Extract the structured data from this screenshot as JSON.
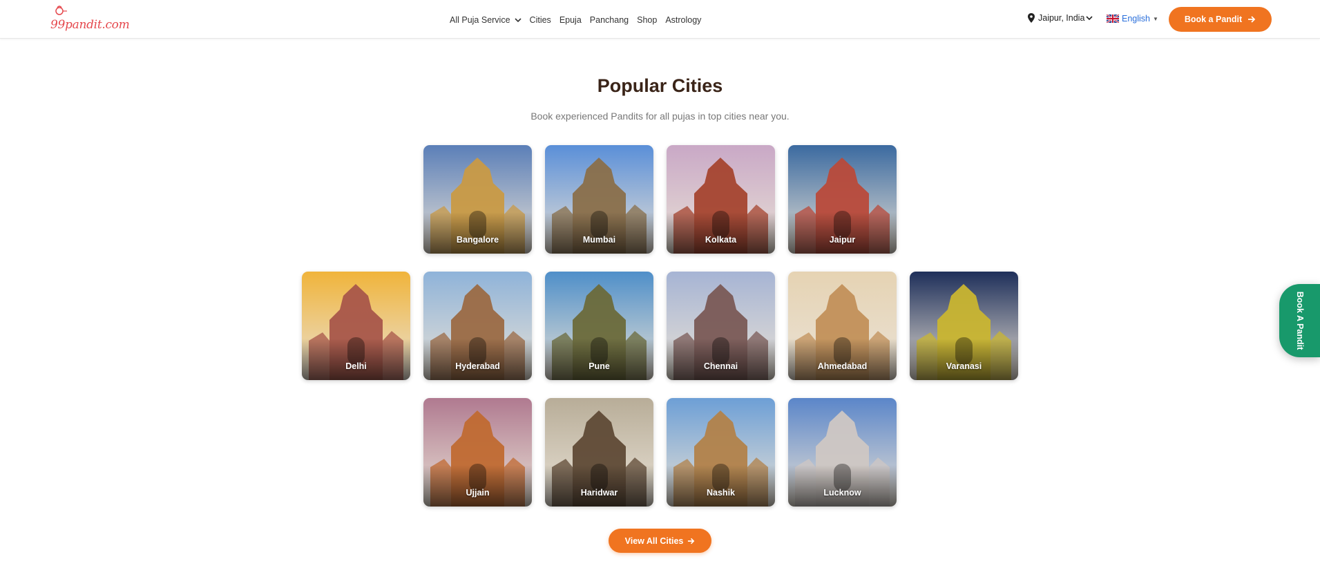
{
  "header": {
    "logo_text": "99pandit.com",
    "nav": [
      {
        "label": "All Puja Service",
        "has_dropdown": true
      },
      {
        "label": "Cities"
      },
      {
        "label": "Epuja"
      },
      {
        "label": "Panchang"
      },
      {
        "label": "Shop"
      },
      {
        "label": "Astrology"
      }
    ],
    "location": "Jaipur, India",
    "language": "English",
    "book_button": "Book a Pandit"
  },
  "section": {
    "title": "Popular Cities",
    "subtitle": "Book experienced Pandits for all pujas in top cities near you."
  },
  "cities": [
    {
      "name": "Bangalore",
      "sky": "#5b7fb8",
      "ground": "#c99a45"
    },
    {
      "name": "Mumbai",
      "sky": "#5a8fd8",
      "ground": "#8a6f4a"
    },
    {
      "name": "Kolkata",
      "sky": "#c9a8c6",
      "ground": "#a5442f"
    },
    {
      "name": "Jaipur",
      "sky": "#3b6aa0",
      "ground": "#b94a3a"
    },
    {
      "name": "Delhi",
      "sky": "#f0b43b",
      "ground": "#a8564a"
    },
    {
      "name": "Hyderabad",
      "sky": "#8fb3d9",
      "ground": "#9b6a44"
    },
    {
      "name": "Pune",
      "sky": "#4f8fc9",
      "ground": "#6b6a3a"
    },
    {
      "name": "Chennai",
      "sky": "#a6b4d4",
      "ground": "#7a5a56"
    },
    {
      "name": "Ahmedabad",
      "sky": "#e6d3b3",
      "ground": "#c2905a"
    },
    {
      "name": "Varanasi",
      "sky": "#1e2f5a",
      "ground": "#c9b530"
    },
    {
      "name": "Ujjain",
      "sky": "#b07a90",
      "ground": "#c06a32"
    },
    {
      "name": "Haridwar",
      "sky": "#b8ad98",
      "ground": "#5f4a36"
    },
    {
      "name": "Nashik",
      "sky": "#6d9fd6",
      "ground": "#b2824a"
    },
    {
      "name": "Lucknow",
      "sky": "#5b86c9",
      "ground": "#cfc7c3"
    }
  ],
  "view_all_button": "View All Cities",
  "side_tab": "Book A Pandit",
  "colors": {
    "accent": "#f07420",
    "side_tab": "#18996b",
    "title": "#3a2418"
  }
}
